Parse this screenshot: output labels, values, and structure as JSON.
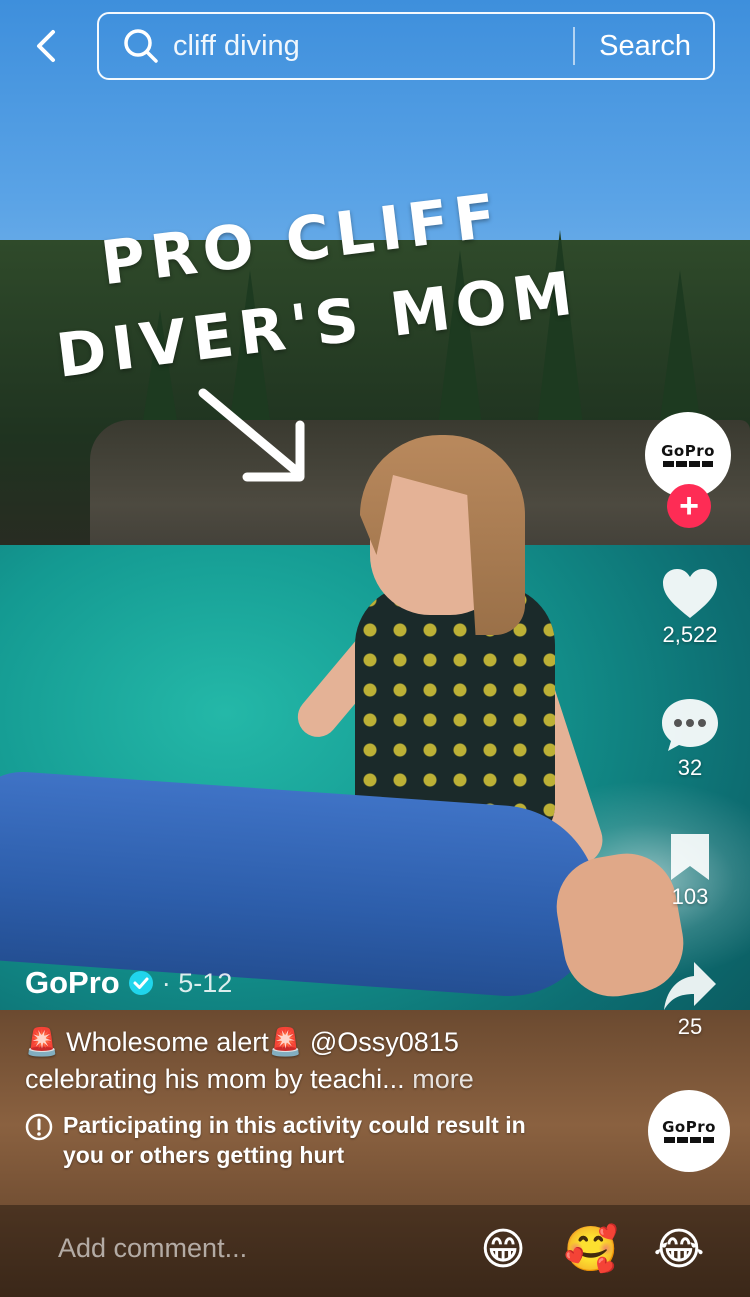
{
  "top_bar": {
    "back_icon": "chevron-left-icon",
    "search_query": "cliff diving",
    "search_button_label": "Search"
  },
  "video": {
    "overlay_text_line1": "PRO CLIFF",
    "overlay_text_line2": "DIVER'S MOM"
  },
  "rail": {
    "avatar_label": "GoPro",
    "likes": "2,522",
    "comments": "32",
    "saves": "103",
    "shares": "25"
  },
  "post": {
    "author": "GoPro",
    "date": "· 5-12",
    "caption_text": "Wholesome alert",
    "mention": "@Ossy0815",
    "caption_line2": "celebrating his mom by teachi...",
    "more_label": "more",
    "warning": "Participating in this activity could result in you or others getting hurt"
  },
  "comment_bar": {
    "placeholder": "Add comment...",
    "emojis": [
      "😁",
      "🥰",
      "😂"
    ]
  },
  "colors": {
    "follow": "#fe2c55",
    "verified": "#20d5ec"
  }
}
